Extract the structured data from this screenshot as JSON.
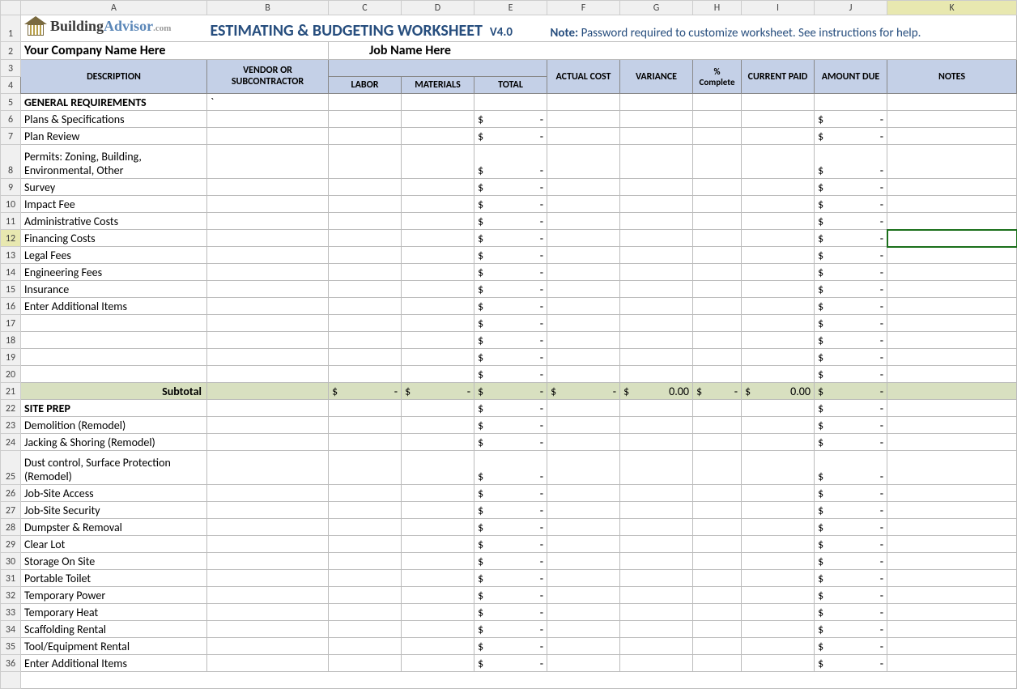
{
  "columns": [
    "A",
    "B",
    "C",
    "D",
    "E",
    "F",
    "G",
    "H",
    "I",
    "J",
    "K"
  ],
  "activeColumn": "K",
  "activeRow": 12,
  "logo": {
    "part1": "Building",
    "part2": "Advisor",
    "dot": ".com"
  },
  "title": "ESTIMATING &  BUDGETING WORKSHEET",
  "version": "V4.0",
  "note_label": "Note:",
  "note_text": "Password required to customize worksheet. See instructions for help.",
  "company_placeholder": "Your Company Name Here",
  "job_placeholder": "Job Name Here",
  "headers": {
    "description": "DESCRIPTION",
    "vendor": "VENDOR  OR SUBCONTRACTOR",
    "labor": "LABOR",
    "materials": "MATERIALS",
    "total": "TOTAL",
    "actual": "ACTUAL COST",
    "variance": "VARIANCE",
    "pct": "% Complete",
    "paid": "CURRENT PAID",
    "due": "AMOUNT DUE",
    "notes": "NOTES"
  },
  "rows": [
    {
      "n": 5,
      "type": "section",
      "desc": "GENERAL REQUIREMENTS",
      "b": "`",
      "e": "",
      "j": ""
    },
    {
      "n": 6,
      "type": "item",
      "desc": "Plans & Specifications",
      "e": "$  -",
      "j": "$  -"
    },
    {
      "n": 7,
      "type": "item",
      "desc": "Plan Review",
      "e": "$  -",
      "j": "$  -"
    },
    {
      "n": 8,
      "type": "item",
      "desc": "Permits: Zoning, Building, Environmental, Other",
      "tall": true,
      "e": "$  -",
      "j": "$  -"
    },
    {
      "n": 9,
      "type": "item",
      "desc": "Survey",
      "e": "$  -",
      "j": "$  -"
    },
    {
      "n": 10,
      "type": "item",
      "desc": "Impact Fee",
      "e": "$  -",
      "j": "$  -"
    },
    {
      "n": 11,
      "type": "item",
      "desc": "Administrative Costs",
      "e": "$  -",
      "j": "$  -"
    },
    {
      "n": 12,
      "type": "item",
      "desc": "Financing Costs",
      "e": "$  -",
      "j": "$  -",
      "active": true
    },
    {
      "n": 13,
      "type": "item",
      "desc": "Legal Fees",
      "e": "$  -",
      "j": "$  -"
    },
    {
      "n": 14,
      "type": "item",
      "desc": "Engineering Fees",
      "e": "$  -",
      "j": "$  -"
    },
    {
      "n": 15,
      "type": "item",
      "desc": "Insurance",
      "e": "$  -",
      "j": "$  -"
    },
    {
      "n": 16,
      "type": "item",
      "desc": "Enter Additional Items",
      "e": "$  -",
      "j": "$  -"
    },
    {
      "n": 17,
      "type": "item",
      "desc": "",
      "e": "$  -",
      "j": "$  -"
    },
    {
      "n": 18,
      "type": "item",
      "desc": "",
      "e": "$  -",
      "j": "$  -"
    },
    {
      "n": 19,
      "type": "item",
      "desc": "",
      "e": "$  -",
      "j": "$  -"
    },
    {
      "n": 20,
      "type": "item",
      "desc": "",
      "e": "$  -",
      "j": "$  -"
    },
    {
      "n": 21,
      "type": "subtotal",
      "desc": "Subtotal",
      "c": "$  -",
      "d": "$  -",
      "e": "$  -",
      "f": "$  -",
      "g": "$0.00",
      "h": "$  -",
      "i": "$0.00",
      "j": "$  -"
    },
    {
      "n": 22,
      "type": "section",
      "desc": "SITE PREP",
      "e": "$  -",
      "j": "$  -"
    },
    {
      "n": 23,
      "type": "item",
      "desc": "Demolition (Remodel)",
      "e": "$  -",
      "j": "$  -"
    },
    {
      "n": 24,
      "type": "item",
      "desc": "Jacking & Shoring (Remodel)",
      "e": "$  -",
      "j": "$  -"
    },
    {
      "n": 25,
      "type": "item",
      "desc": "Dust control, Surface Protection (Remodel)",
      "tall": true,
      "e": "$  -",
      "j": "$  -"
    },
    {
      "n": 26,
      "type": "item",
      "desc": "Job-Site Access",
      "e": "$  -",
      "j": "$  -"
    },
    {
      "n": 27,
      "type": "item",
      "desc": "Job-Site Security",
      "e": "$  -",
      "j": "$  -"
    },
    {
      "n": 28,
      "type": "item",
      "desc": "Dumpster & Removal",
      "e": "$  -",
      "j": "$  -"
    },
    {
      "n": 29,
      "type": "item",
      "desc": "Clear Lot",
      "e": "$  -",
      "j": "$  -"
    },
    {
      "n": 30,
      "type": "item",
      "desc": "Storage On Site",
      "e": "$  -",
      "j": "$  -"
    },
    {
      "n": 31,
      "type": "item",
      "desc": "Portable Toilet",
      "e": "$  -",
      "j": "$  -"
    },
    {
      "n": 32,
      "type": "item",
      "desc": "Temporary Power",
      "e": "$  -",
      "j": "$  -"
    },
    {
      "n": 33,
      "type": "item",
      "desc": "Temporary Heat",
      "e": "$  -",
      "j": "$  -"
    },
    {
      "n": 34,
      "type": "item",
      "desc": "Scaffolding Rental",
      "e": "$  -",
      "j": "$  -"
    },
    {
      "n": 35,
      "type": "item",
      "desc": "Tool/Equipment Rental",
      "e": "$  -",
      "j": "$  -"
    },
    {
      "n": 36,
      "type": "item",
      "desc": "Enter Additional Items",
      "e": "$  -",
      "j": "$  -"
    }
  ]
}
